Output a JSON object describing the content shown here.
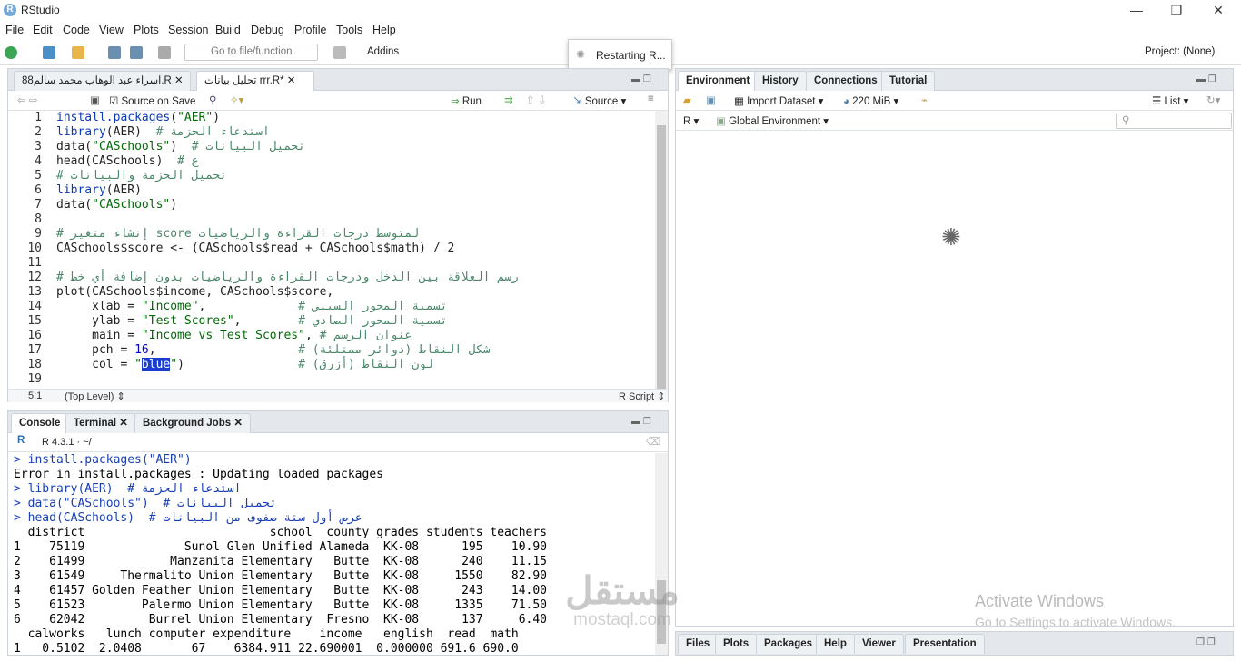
{
  "window": {
    "title": "RStudio",
    "minimize": "—",
    "restore": "❐",
    "close": "✕"
  },
  "menu": [
    "File",
    "Edit",
    "Code",
    "View",
    "Plots",
    "Session",
    "Build",
    "Debug",
    "Profile",
    "Tools",
    "Help"
  ],
  "toolbar": {
    "goto_placeholder": "Go to file/function",
    "addins": "Addins",
    "project": "Project: (None)"
  },
  "popup": {
    "text": "Restarting R..."
  },
  "editor": {
    "tabs": [
      "اسراء عبد الوهاب محمد سالم88.R",
      "تحليل بيانات rrr.R*"
    ],
    "source_on_save": "Source on Save",
    "run": "Run",
    "source": "Source",
    "status_pos": "5:1",
    "status_scope": "(Top Level)",
    "status_type": "R Script",
    "lines": [
      "install.packages(\"AER\")",
      "library(AER)  # استدعاء الحزمة",
      "data(\"CASchools\")  # تحميل البيانات",
      "head(CASchools)  # ع",
      "# تحميل الحزمة والبيانات",
      "library(AER)",
      "data(\"CASchools\")",
      "",
      "# إنشاء متغير score لمتوسط درجات القراءة والرياضيات",
      "CASchools$score <- (CASchools$read + CASchools$math) / 2",
      "",
      "# رسم العلاقة بين الدخل ودرجات القراءة والرياضيات بدون إضافة أي خط",
      "plot(CASchools$income, CASchools$score,",
      "     xlab = \"Income\",             # تسمية المحور السيني",
      "     ylab = \"Test Scores\",        # تسمية المحور الصادي",
      "     main = \"Income vs Test Scores\", # عنوان الرسم",
      "     pch = 16,                    # شكل النقاط (دوائر ممتلئة)",
      "     col = \"blue\")                # لون النقاط (أزرق)",
      ""
    ]
  },
  "console": {
    "tabs": [
      "Console",
      "Terminal",
      "Background Jobs"
    ],
    "version": "R 4.3.1 · ~/",
    "lines": [
      "> install.packages(\"AER\")",
      "Error in install.packages : Updating loaded packages",
      "> library(AER)  # استدعاء الحزمة",
      "> data(\"CASchools\")  # تحميل البيانات",
      "> head(CASchools)  # عرض أول ستة صفوف من البيانات",
      "  district                          school  county grades students teachers",
      "1    75119              Sunol Glen Unified Alameda  KK-08      195    10.90",
      "2    61499            Manzanita Elementary   Butte  KK-08      240    11.15",
      "3    61549     Thermalito Union Elementary   Butte  KK-08     1550    82.90",
      "4    61457 Golden Feather Union Elementary   Butte  KK-08      243    14.00",
      "5    61523        Palermo Union Elementary   Butte  KK-08     1335    71.50",
      "6    62042         Burrel Union Elementary  Fresno  KK-08      137     6.40",
      "  calworks   lunch computer expenditure    income   english  read  math",
      "1   0.5102  2.0408       67    6384.911 22.690001  0.000000 691.6 690.0"
    ]
  },
  "env": {
    "tabs": [
      "Environment",
      "History",
      "Connections",
      "Tutorial"
    ],
    "import": "Import Dataset",
    "memory": "220 MiB",
    "list": "List",
    "r_label": "R",
    "global": "Global Environment"
  },
  "files": {
    "tabs": [
      "Files",
      "Plots",
      "Packages",
      "Help",
      "Viewer",
      "Presentation"
    ]
  },
  "watermark": {
    "line1": "Activate Windows",
    "line2": "Go to Settings to activate Windows.",
    "brand": "mostaql.com",
    "brand_ar": "مستقل"
  }
}
